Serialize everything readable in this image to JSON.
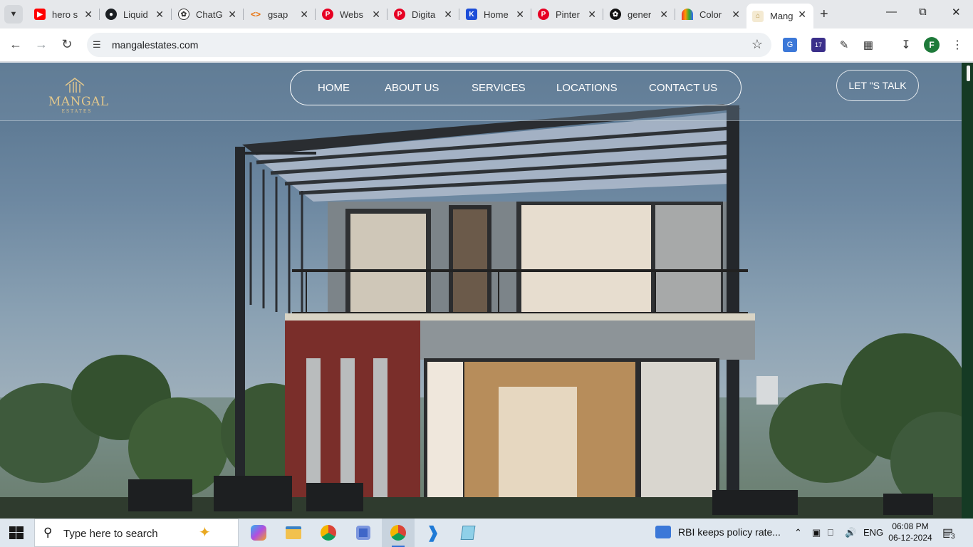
{
  "browser": {
    "tabs": [
      {
        "title": "hero s",
        "icon": "youtube-icon",
        "color": "#ff0000"
      },
      {
        "title": "Liquid",
        "icon": "github-icon",
        "color": "#1b1f23"
      },
      {
        "title": "ChatG",
        "icon": "chatgpt-icon",
        "color": "#444444"
      },
      {
        "title": "gsap",
        "icon": "code-icon",
        "color": "#e8710a"
      },
      {
        "title": "Webs",
        "icon": "pinterest-icon",
        "color": "#e60023"
      },
      {
        "title": "Digita",
        "icon": "pinterest-icon",
        "color": "#e60023"
      },
      {
        "title": "Home",
        "icon": "k-icon",
        "color": "#1d4ed8"
      },
      {
        "title": "Pinter",
        "icon": "pinterest-icon",
        "color": "#e60023"
      },
      {
        "title": "gener",
        "icon": "openai-icon",
        "color": "#111111"
      },
      {
        "title": "Color",
        "icon": "rainbow-icon",
        "color": "#e86b3a"
      },
      {
        "title": "Mang",
        "icon": "mangal-icon",
        "color": "#d9b96e"
      }
    ],
    "url": "mangalestates.com",
    "profile_initial": "F",
    "extension_badge": "17"
  },
  "site": {
    "logo_name": "MANGAL",
    "logo_sub": "ESTATES",
    "nav": [
      "HOME",
      "ABOUT US",
      "SERVICES",
      "LOCATIONS",
      "CONTACT US"
    ],
    "cta": "LET \"S TALK",
    "accent_color": "#e2c78c"
  },
  "taskbar": {
    "search_placeholder": "Type here to search",
    "news": "RBI keeps policy rate...",
    "language": "ENG",
    "time": "06:08 PM",
    "date": "06-12-2024",
    "notification_count": "3"
  }
}
